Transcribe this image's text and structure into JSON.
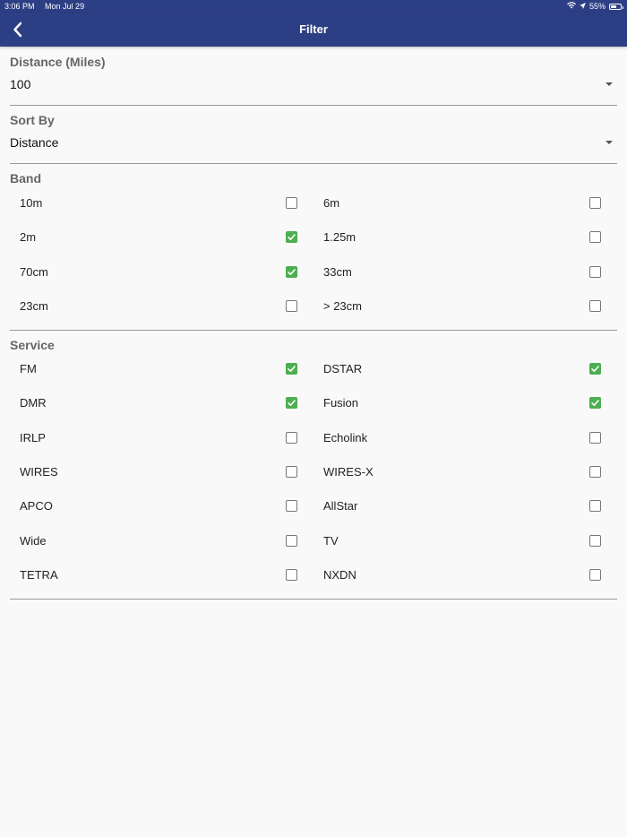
{
  "status_bar": {
    "time": "3:06 PM",
    "date": "Mon Jul 29",
    "battery_text": "55%",
    "battery_level": 0.55
  },
  "nav": {
    "title": "Filter",
    "back_icon": "chevron-left-icon"
  },
  "colors": {
    "nav_bg": "#2d3f84",
    "check_green": "#4caf50"
  },
  "distance": {
    "label": "Distance (Miles)",
    "value": "100"
  },
  "sort": {
    "label": "Sort By",
    "value": "Distance"
  },
  "band": {
    "label": "Band",
    "options": [
      {
        "label": "10m",
        "checked": false
      },
      {
        "label": "6m",
        "checked": false
      },
      {
        "label": "2m",
        "checked": true
      },
      {
        "label": "1.25m",
        "checked": false
      },
      {
        "label": "70cm",
        "checked": true
      },
      {
        "label": "33cm",
        "checked": false
      },
      {
        "label": "23cm",
        "checked": false
      },
      {
        "label": "> 23cm",
        "checked": false
      }
    ]
  },
  "service": {
    "label": "Service",
    "options": [
      {
        "label": "FM",
        "checked": true
      },
      {
        "label": "DSTAR",
        "checked": true
      },
      {
        "label": "DMR",
        "checked": true
      },
      {
        "label": "Fusion",
        "checked": true
      },
      {
        "label": "IRLP",
        "checked": false
      },
      {
        "label": "Echolink",
        "checked": false
      },
      {
        "label": "WIRES",
        "checked": false
      },
      {
        "label": "WIRES-X",
        "checked": false
      },
      {
        "label": "APCO",
        "checked": false
      },
      {
        "label": "AllStar",
        "checked": false
      },
      {
        "label": "Wide",
        "checked": false
      },
      {
        "label": "TV",
        "checked": false
      },
      {
        "label": "TETRA",
        "checked": false
      },
      {
        "label": "NXDN",
        "checked": false
      }
    ]
  }
}
